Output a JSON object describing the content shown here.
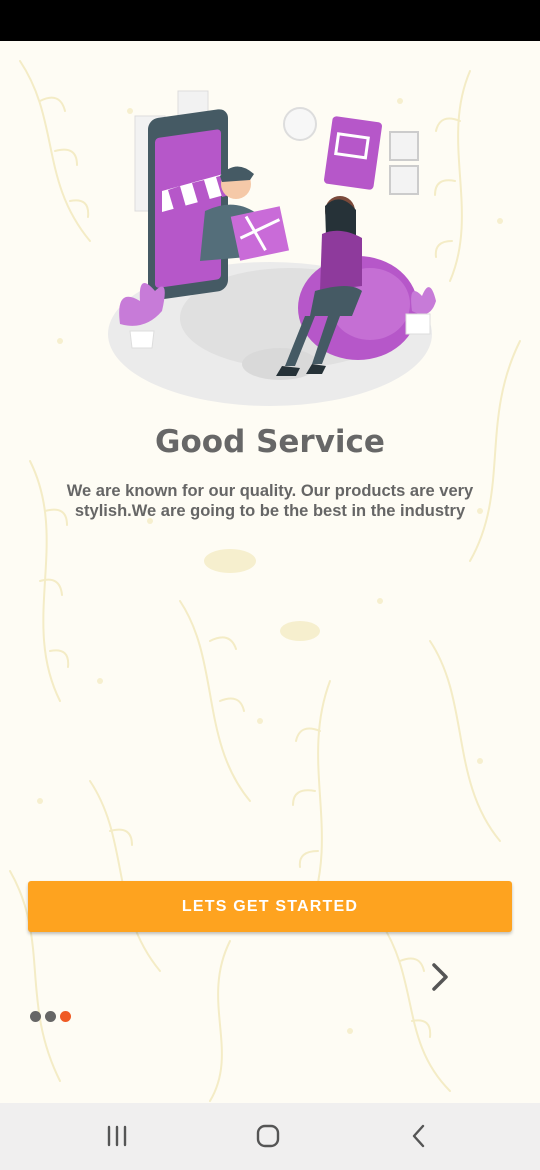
{
  "onboarding": {
    "title": "Good Service",
    "description": "We are known for our quality. Our products are very stylish.We are going to be the best in the industry",
    "cta_label": "LETS GET STARTED",
    "page_indicator": {
      "count": 3,
      "active_index": 2
    }
  },
  "icons": {
    "next": "chevron-right-icon",
    "recent_apps": "recent-apps-icon",
    "home": "home-icon",
    "back": "back-icon"
  },
  "colors": {
    "accent": "#fea31f",
    "title_text": "#676767",
    "body_text": "#666666",
    "illustration_purple": "#b657c9",
    "indicator_inactive": "#666666",
    "indicator_active": "#ef5a24"
  }
}
